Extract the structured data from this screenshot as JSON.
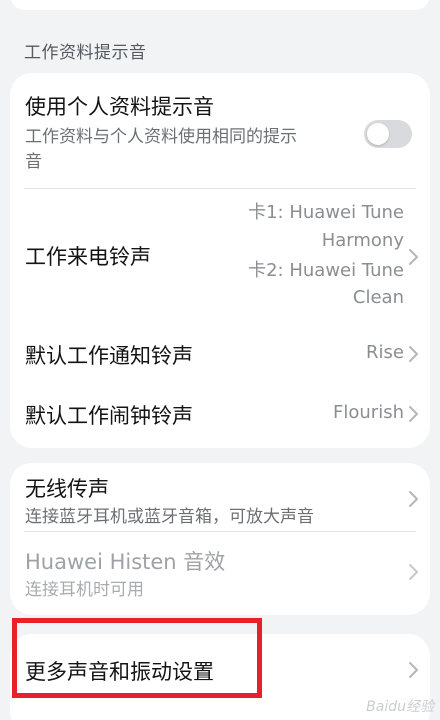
{
  "section": {
    "title": "工作资料提示音"
  },
  "work": {
    "use_personal": {
      "title": "使用个人资料提示音",
      "subtitle_line1": "工作资料与个人资料使用相同的提示",
      "subtitle_line2": "音",
      "toggle_on": false
    },
    "ringtone": {
      "title": "工作来电铃声",
      "value_line1": "卡1: Huawei Tune",
      "value_line2": "Harmony",
      "value_line3": "卡2: Huawei Tune",
      "value_line4": "Clean"
    },
    "notification": {
      "title": "默认工作通知铃声",
      "value": "Rise"
    },
    "alarm": {
      "title": "默认工作闹钟铃声",
      "value": "Flourish"
    }
  },
  "wireless": {
    "projection": {
      "title": "无线传声",
      "subtitle": "连接蓝牙耳机或蓝牙音箱，可放大声音"
    },
    "histen": {
      "title": "Huawei Histen 音效",
      "subtitle": "连接耳机时可用"
    }
  },
  "more": {
    "title": "更多声音和振动设置"
  },
  "watermark": {
    "text": "Baidu经验"
  },
  "colors": {
    "background": "#f1f3f5",
    "card": "#ffffff",
    "highlight": "#e8202a",
    "toggle_off": "#d8dadd"
  }
}
